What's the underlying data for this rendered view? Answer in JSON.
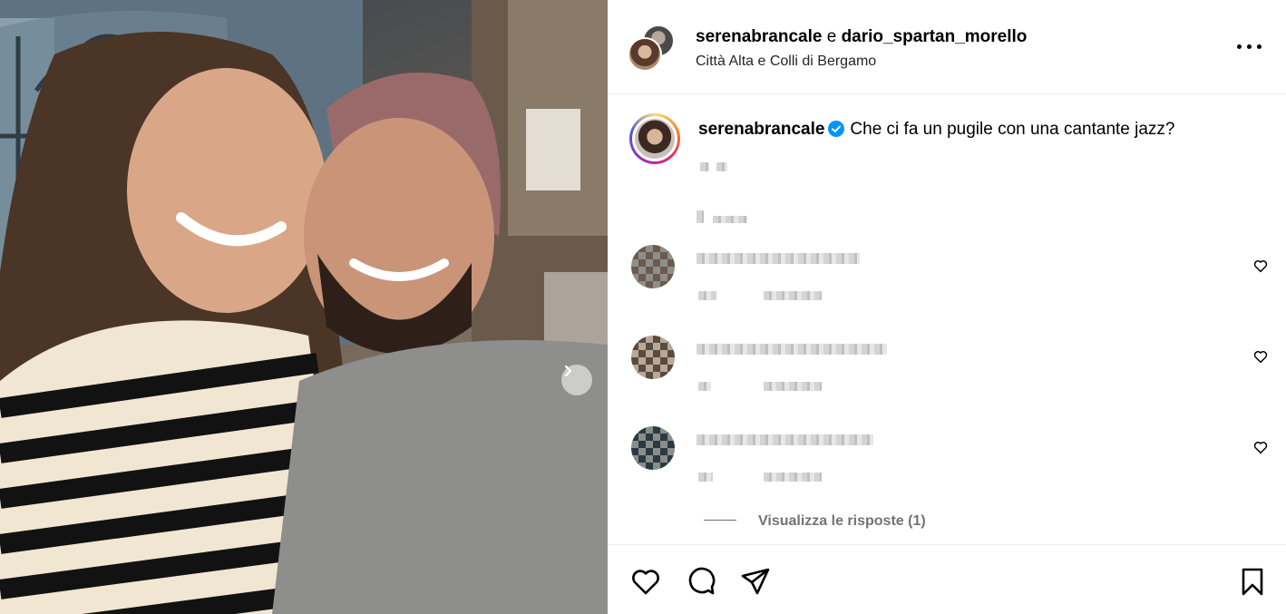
{
  "post": {
    "author_primary": "serenabrancale",
    "conjunction": "e",
    "author_secondary": "dario_spartan_morello",
    "location": "Città Alta e Colli di Bergamo",
    "more_icon": "more-horizontal-icon"
  },
  "caption": {
    "username": "serenabrancale",
    "verified": true,
    "text": "Che ci fa un pugile con una cantante jazz?"
  },
  "comments": [
    {
      "heart_icon": "heart-outline-icon"
    },
    {
      "heart_icon": "heart-outline-icon"
    },
    {
      "heart_icon": "heart-outline-icon"
    }
  ],
  "view_replies_label": "Visualizza le risposte (1)",
  "actions": {
    "like_icon": "heart-icon",
    "comment_icon": "comment-icon",
    "share_icon": "send-icon",
    "save_icon": "bookmark-icon"
  },
  "colors": {
    "verified_badge": "#0095f6",
    "secondary_text": "#737373",
    "divider": "#efefef"
  }
}
